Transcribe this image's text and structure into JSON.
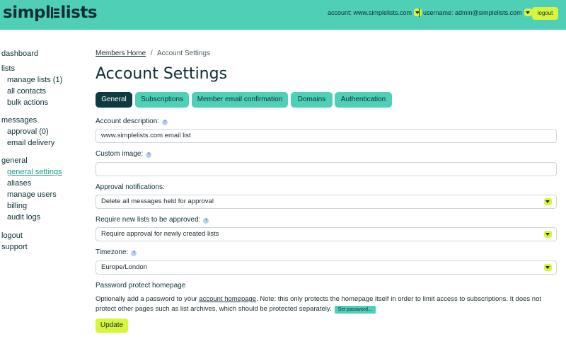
{
  "header": {
    "logo_text_a": "simpl",
    "logo_text_b": "lists",
    "account_label": "account: www.simplelists.com",
    "username_label": "username: admin@simplelists.com",
    "logout_label": "logout"
  },
  "sidebar": {
    "dashboard": "dashboard",
    "lists": "lists",
    "manage_lists": "manage lists (1)",
    "all_contacts": "all contacts",
    "bulk_actions": "bulk actions",
    "messages": "messages",
    "approval": "approval (0)",
    "email_delivery": "email delivery",
    "general": "general",
    "general_settings": "general settings",
    "aliases": "aliases",
    "manage_users": "manage users",
    "billing": "billing",
    "audit_logs": "audit logs",
    "logout": "logout",
    "support": "support"
  },
  "breadcrumb": {
    "home": "Members Home",
    "separator": "/",
    "current": "Account Settings"
  },
  "page_title": "Account Settings",
  "tabs": {
    "general": "General",
    "subscriptions": "Subscriptions",
    "member_email_confirmation": "Member email confirmation",
    "domains": "Domains",
    "authentication": "Authentication"
  },
  "form": {
    "account_description_label": "Account description:",
    "account_description_value": "www.simplelists.com email list",
    "custom_image_label": "Custom image:",
    "custom_image_value": "",
    "approval_notifications_label": "Approval notifications:",
    "approval_notifications_value": "Delete all messages held for approval",
    "require_approval_label": "Require new lists to be approved:",
    "require_approval_value": "Require approval for newly created lists",
    "timezone_label": "Timezone:",
    "timezone_value": "Europe/London",
    "password_protect_label": "Password protect homepage",
    "password_text_1": "Optionally add a password to your ",
    "password_link": "account homepage",
    "password_text_2": ". Note: this only protects the homepage itself in order to limit access to subscriptions. It does not protect other pages such as list archives, which should be protected separately.",
    "set_password_label": "Set password...",
    "update_label": "Update",
    "help_glyph": "?"
  },
  "colors": {
    "header_bg": "#4fcfb6",
    "accent_lime": "#d7f53a",
    "active_tab": "#0d3b40",
    "active_link": "#1a9e8c"
  }
}
